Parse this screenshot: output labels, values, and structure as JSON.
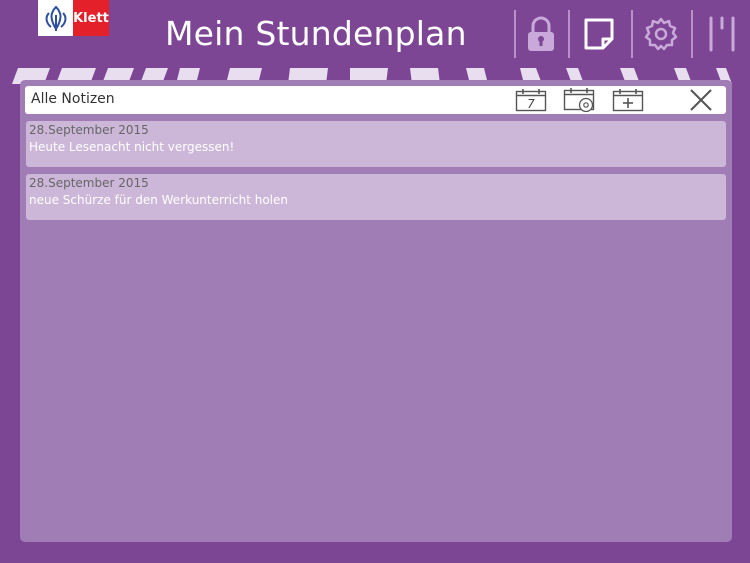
{
  "header": {
    "logo_text": "Klett",
    "title": "Mein Stundenplan",
    "icons": [
      "lock-icon",
      "notes-icon",
      "gear-icon",
      "timetable-icon"
    ]
  },
  "notes_panel": {
    "title": "Alle Notizen",
    "toolbar_icons": [
      "calendar-day-icon",
      "calendar-settings-icon",
      "calendar-add-icon",
      "close-icon"
    ],
    "calendar_day_number": "7",
    "notes": [
      {
        "date": "28.September 2015",
        "text": "Heute Lesenacht nicht vergessen!"
      },
      {
        "date": "28.September 2015",
        "text": "neue Schürze für den Werkunterricht holen"
      }
    ]
  },
  "colors": {
    "background": "#7d4694",
    "panel": "#a07db4",
    "note": "#cdb7d9",
    "logo_red": "#e4202a"
  }
}
